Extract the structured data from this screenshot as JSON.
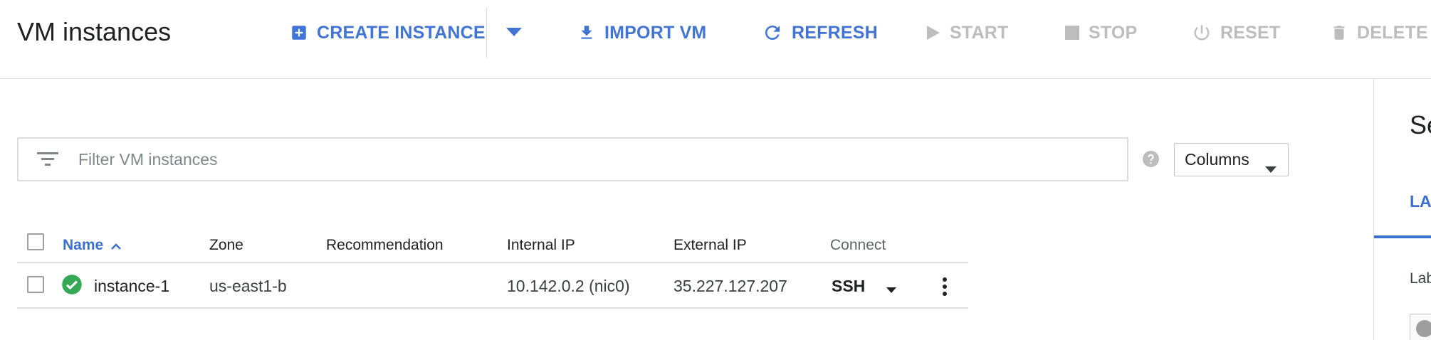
{
  "header": {
    "title": "VM instances",
    "actions": {
      "create_instance": "CREATE INSTANCE",
      "import_vm": "IMPORT VM",
      "refresh": "REFRESH",
      "start": "START",
      "stop": "STOP",
      "reset": "RESET",
      "delete": "DELETE"
    }
  },
  "filter": {
    "placeholder": "Filter VM instances",
    "value": "",
    "columns_label": "Columns"
  },
  "table": {
    "headers": {
      "name": "Name",
      "zone": "Zone",
      "recommendation": "Recommendation",
      "internal_ip": "Internal IP",
      "external_ip": "External IP",
      "connect": "Connect"
    },
    "sort": {
      "column": "name",
      "direction": "ascending"
    },
    "rows": [
      {
        "status": "running",
        "name": "instance-1",
        "zone": "us-east1-b",
        "recommendation": "",
        "internal_ip": "10.142.0.2 (nic0)",
        "external_ip": "35.227.127.207",
        "connect": "SSH"
      }
    ]
  },
  "side_panel": {
    "title_fragment": "Se",
    "tab_fragment": "LA",
    "label_fragment": "Lab"
  },
  "colors": {
    "accent": "#4175d5",
    "disabled": "#bdbdbd",
    "status_ok": "#34a853",
    "divider": "#dadce0"
  },
  "icons": {
    "create": "add-box-icon",
    "import": "download-icon",
    "refresh": "refresh-icon",
    "start": "play-icon",
    "stop": "stop-icon",
    "reset": "power-icon",
    "delete": "trash-icon",
    "filter": "filter-list-icon",
    "help": "help-icon",
    "status": "check-circle-icon",
    "more": "more-vert-icon"
  }
}
